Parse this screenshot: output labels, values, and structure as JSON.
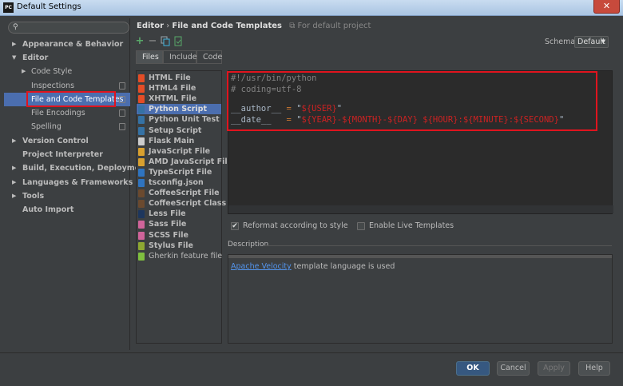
{
  "window": {
    "app_icon": "PC",
    "title": "Default Settings",
    "close_label": "✕"
  },
  "sidebar": {
    "search_icon": "search-icon",
    "items": [
      {
        "label": "Appearance & Behavior",
        "arrow": "▶",
        "bold": true
      },
      {
        "label": "Editor",
        "arrow": "▼",
        "bold": true
      },
      {
        "label": "Code Style",
        "arrow": "▶",
        "bold": false
      },
      {
        "label": "Inspections",
        "arrow": "",
        "bold": false
      },
      {
        "label": "File and Code Templates",
        "arrow": "",
        "bold": false,
        "selected": true
      },
      {
        "label": "File Encodings",
        "arrow": "",
        "bold": false
      },
      {
        "label": "Spelling",
        "arrow": "",
        "bold": false
      },
      {
        "label": "Version Control",
        "arrow": "▶",
        "bold": true
      },
      {
        "label": "Project Interpreter",
        "arrow": "",
        "bold": true
      },
      {
        "label": "Build, Execution, Deployment",
        "arrow": "▶",
        "bold": true
      },
      {
        "label": "Languages & Frameworks",
        "arrow": "▶",
        "bold": true
      },
      {
        "label": "Tools",
        "arrow": "▶",
        "bold": true
      },
      {
        "label": "Auto Import",
        "arrow": "",
        "bold": true
      }
    ]
  },
  "header": {
    "breadcrumb_root": "Editor",
    "breadcrumb_sep": "›",
    "breadcrumb_current": "File and Code Templates",
    "scope": "For default project",
    "schema_label": "Schema:",
    "schema_value": "Default"
  },
  "toolbar": {
    "add_symbol": "+",
    "remove_symbol": "−"
  },
  "tabs": [
    "Files",
    "Includes",
    "Code"
  ],
  "templates": [
    {
      "label": "HTML File",
      "color": "#e44d26"
    },
    {
      "label": "HTML4 File",
      "color": "#e44d26"
    },
    {
      "label": "XHTML File",
      "color": "#e44d26"
    },
    {
      "label": "Python Script",
      "color": "#3572a5",
      "selected": true
    },
    {
      "label": "Python Unit Test",
      "color": "#3572a5"
    },
    {
      "label": "Setup Script",
      "color": "#3572a5"
    },
    {
      "label": "Flask Main",
      "color": "#cccccc"
    },
    {
      "label": "JavaScript File",
      "color": "#d8a02f"
    },
    {
      "label": "AMD JavaScript File",
      "color": "#d8a02f"
    },
    {
      "label": "TypeScript File",
      "color": "#2f74c0"
    },
    {
      "label": "tsconfig.json",
      "color": "#2f74c0"
    },
    {
      "label": "CoffeeScript File",
      "color": "#6b4a2f"
    },
    {
      "label": "CoffeeScript Class",
      "color": "#6b4a2f"
    },
    {
      "label": "Less File",
      "color": "#1d365d"
    },
    {
      "label": "Sass File",
      "color": "#cf649a"
    },
    {
      "label": "SCSS File",
      "color": "#cf649a"
    },
    {
      "label": "Stylus File",
      "color": "#8da832"
    },
    {
      "label": "Gherkin feature file",
      "color": "#7fbf3f",
      "normal": true
    }
  ],
  "editor": {
    "line1": "#!/usr/bin/python",
    "line2": "# coding=utf-8",
    "author_key": "__author__",
    "date_key": "__date__",
    "eq": "=",
    "quote": "\"",
    "author_val": "${USER}",
    "date_val": "${YEAR}-${MONTH}-${DAY} ${HOUR}:${MINUTE}:${SECOND}"
  },
  "options": {
    "reformat_label": "Reformat according to style",
    "reformat_checked": "✔",
    "live_templates_label": "Enable Live Templates"
  },
  "description": {
    "section_label": "Description",
    "link_text": "Apache Velocity",
    "text": " template language is used"
  },
  "buttons": {
    "ok": "OK",
    "cancel": "Cancel",
    "apply": "Apply",
    "help": "Help"
  },
  "colors": {
    "accent": "#4b6eaf",
    "highlight": "#e0141e"
  }
}
